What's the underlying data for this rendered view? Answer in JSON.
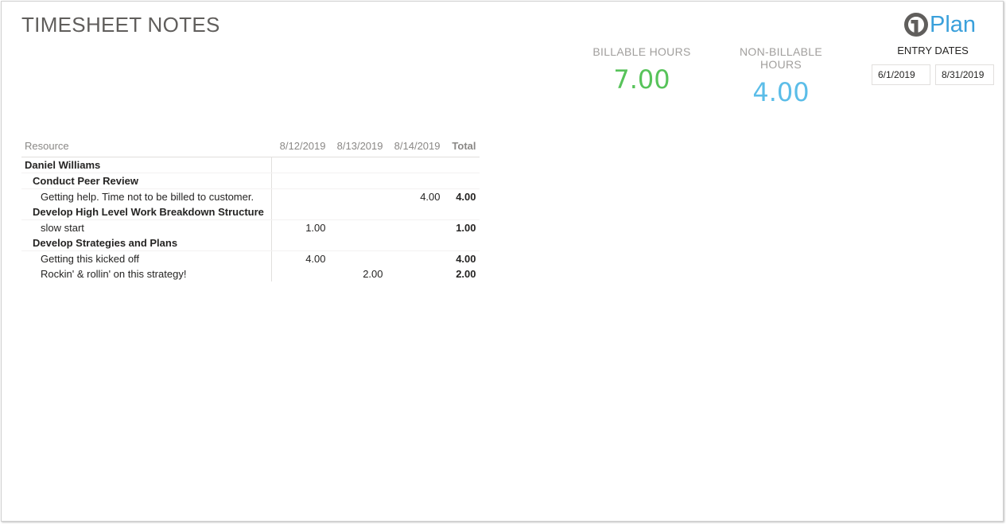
{
  "report": {
    "title": "TIMESHEET NOTES",
    "logo_text": "Plan"
  },
  "kpis": {
    "billable": {
      "label": "BILLABLE HOURS",
      "value": "7.00",
      "color": "#57c35a"
    },
    "non_billable": {
      "label": "NON-BILLABLE HOURS",
      "value": "4.00",
      "color": "#5bbde8"
    }
  },
  "entry_dates": {
    "label": "ENTRY DATES",
    "start": "6/1/2019",
    "end": "8/31/2019"
  },
  "matrix": {
    "headers": {
      "resource": "Resource",
      "date1": "8/12/2019",
      "date2": "8/13/2019",
      "date3": "8/14/2019",
      "total": "Total"
    },
    "rows": [
      {
        "label": "Daniel Williams",
        "d1": "",
        "d2": "",
        "d3": "",
        "total": ""
      },
      {
        "label": "Conduct Peer Review",
        "d1": "",
        "d2": "",
        "d3": "",
        "total": ""
      },
      {
        "label": "Getting help. Time not to be billed to customer.",
        "d1": "",
        "d2": "",
        "d3": "4.00",
        "total": "4.00"
      },
      {
        "label": "Develop High Level Work Breakdown Structure",
        "d1": "",
        "d2": "",
        "d3": "",
        "total": ""
      },
      {
        "label": "slow start",
        "d1": "1.00",
        "d2": "",
        "d3": "",
        "total": "1.00"
      },
      {
        "label": "Develop Strategies and Plans",
        "d1": "",
        "d2": "",
        "d3": "",
        "total": ""
      },
      {
        "label": "Getting this kicked off",
        "d1": "4.00",
        "d2": "",
        "d3": "",
        "total": "4.00"
      },
      {
        "label": "Rockin' & rollin' on this strategy!",
        "d1": "",
        "d2": "2.00",
        "d3": "",
        "total": "2.00"
      }
    ]
  }
}
